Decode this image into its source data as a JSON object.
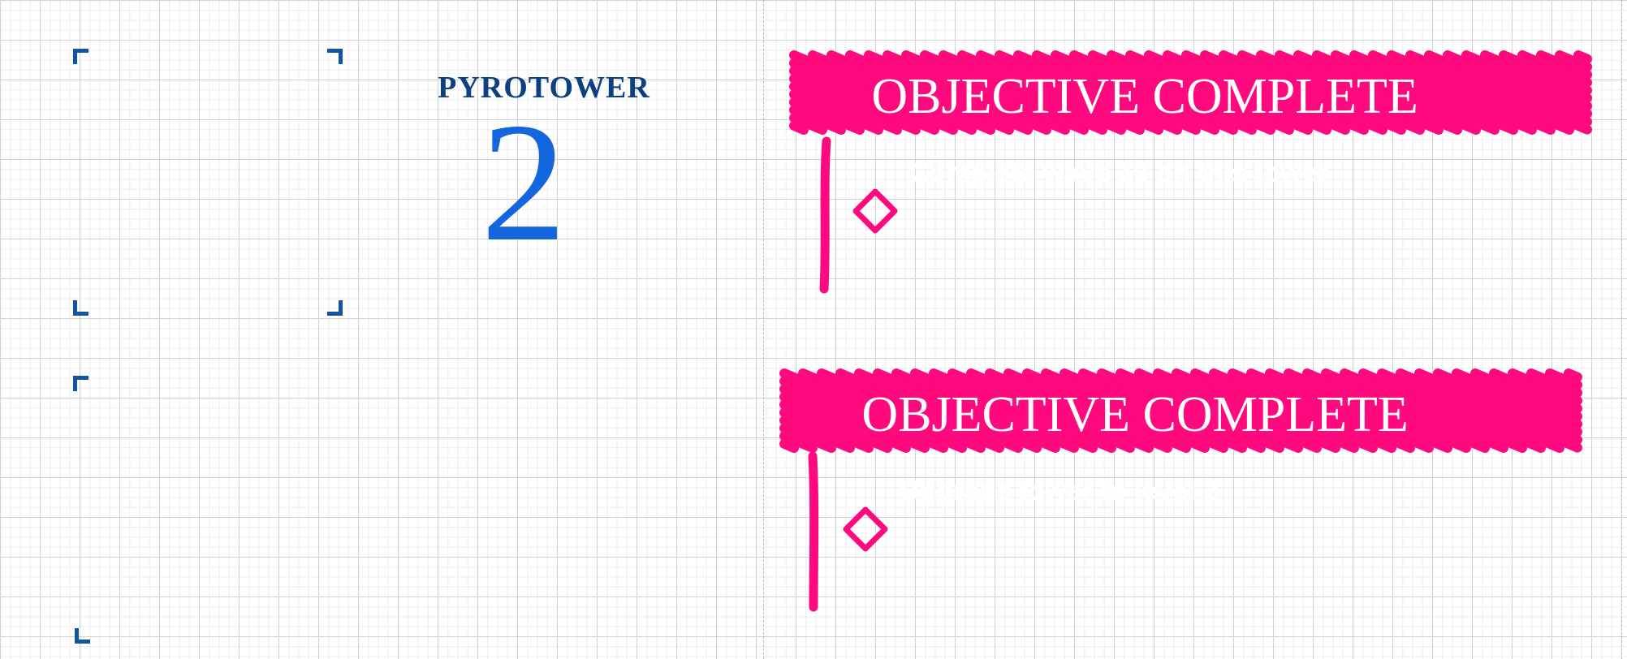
{
  "tower": {
    "name": "PYROTOWER",
    "level": "2"
  },
  "objectives": [
    {
      "banner": "OBJECTIVE COMPLETE",
      "detail": "Complete wave 10 on this tower",
      "marker_icon": "diamond-icon"
    },
    {
      "banner": "OBJECTIVE COMPLETE",
      "detail": "Upgrade tower to level 2",
      "marker_icon": "diamond-icon"
    }
  ],
  "colors": {
    "accent": "#ff0a7e",
    "tower_name": "#0e3f7e",
    "tower_level": "#1366de",
    "frame": "#1354a0",
    "banner_text": "#ffffff"
  }
}
